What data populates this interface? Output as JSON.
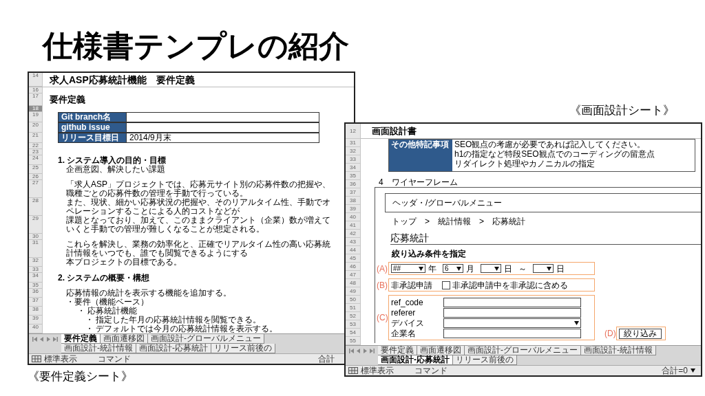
{
  "title": "仕様書テンプレの紹介",
  "requirements_sheet": {
    "caption": "《要件定義シート》",
    "rows": [
      {
        "num": "14",
        "kind": "title",
        "text": "求人ASP応募統計機能　要件定義",
        "selected": false
      },
      {
        "num": "16",
        "kind": "blank",
        "selected": false
      },
      {
        "num": "17",
        "kind": "heading",
        "text": "要件定義",
        "selected": false
      },
      {
        "num": "18",
        "kind": "blank",
        "selected": true
      },
      {
        "num": "19",
        "kind": "field",
        "label": "Git branch名",
        "selected": false
      },
      {
        "num": "20",
        "kind": "field",
        "label": "github issue",
        "selected": false
      },
      {
        "num": "21",
        "kind": "field",
        "label": "リリース目標日",
        "value": "2014/9月末",
        "selected": false
      },
      {
        "num": "22",
        "kind": "blank",
        "selected": false
      },
      {
        "num": "23",
        "kind": "blank",
        "selected": false
      },
      {
        "num": "24",
        "kind": "section",
        "text": "1.  システム導入の目的・目標",
        "selected": false
      },
      {
        "num": "25",
        "kind": "note",
        "text": "企画意図、解決したい課題",
        "selected": false
      },
      {
        "num": "26",
        "kind": "blank",
        "selected": false
      },
      {
        "num": "27",
        "kind": "para",
        "text": "「求人ASP」プロジェクトでは、応募元サイト別の応募件数の把握や、職種ごとの応募件数の管理を手動で行っている。",
        "selected": false
      },
      {
        "num": "28",
        "kind": "para",
        "text": "また、現状、細かい応募状況の把握や、そのリアルタイム性、手動でオペレーションすることによる人的コストなどが",
        "selected": false
      },
      {
        "num": "29",
        "kind": "para",
        "text": "課題となっており、加えて、このままクライアント（企業）数が増えていくと手動での管理が難しくなることが想定される。",
        "selected": false
      },
      {
        "num": "30",
        "kind": "blank",
        "selected": false
      },
      {
        "num": "31",
        "kind": "para",
        "text": "これらを解決し、業務の効率化と、正確でリアルタイム性の高い応募統計情報をいつでも、誰でも閲覧できるようにする",
        "selected": false
      },
      {
        "num": "32",
        "kind": "para",
        "text": "本プロジェクトの目標である。",
        "selected": false
      },
      {
        "num": "33",
        "kind": "blank",
        "selected": false
      },
      {
        "num": "34",
        "kind": "section",
        "text": "2.  システムの概要・構想",
        "selected": false
      },
      {
        "num": "35",
        "kind": "blank",
        "selected": false
      },
      {
        "num": "36",
        "kind": "para",
        "text": "応募情報の統計を表示する機能を追加する。",
        "selected": false
      },
      {
        "num": "37",
        "kind": "para",
        "text": "・要件（機能ベース）",
        "selected": false
      },
      {
        "num": "38",
        "kind": "item",
        "text": "・ 応募統計機能",
        "selected": false
      },
      {
        "num": "39",
        "kind": "subitem",
        "text": "・ 指定した年月の応募統計情報を閲覧できる。",
        "selected": false
      },
      {
        "num": "40",
        "kind": "subitem",
        "text": "・ デフォルトでは今月の応募統計情報を表示する。",
        "selected": false
      }
    ],
    "tabs": [
      {
        "label": "要件定義",
        "selected": true
      },
      {
        "label": "画面遷移図",
        "selected": false
      },
      {
        "label": "画面設計-グローバルメニュー",
        "selected": false
      },
      {
        "label": "画面設計-統計情報",
        "selected": false
      },
      {
        "label": "画面設計-応募統計",
        "selected": false
      },
      {
        "label": "リリース前後の",
        "selected": false
      }
    ],
    "status_bar": {
      "view": "標準表示",
      "mode": "コマンド",
      "sum": "合計"
    }
  },
  "design_sheet": {
    "caption": "《画面設計シート》",
    "row_numbers": [
      "12",
      "31",
      "32",
      "33",
      "34",
      "35",
      "36",
      "37",
      "38",
      "39",
      "40",
      "41",
      "42",
      "43",
      "44",
      "45",
      "46",
      "47",
      "48",
      "49",
      "50",
      "51",
      "52",
      "53",
      "54",
      "55"
    ],
    "heading": "画面設計書",
    "notes_table": {
      "label": "その他特記事項",
      "lines": [
        "SEO観点の考慮が必要であれば記入してください。",
        "h1の指定など特段SEO観点でのコーディングの留意点",
        "リダイレクト処理やカノニカルの指定"
      ]
    },
    "section": "4　ワイヤーフレーム",
    "wireframe": {
      "header": "ヘッダ・/グローバルメニュー",
      "breadcrumb": "トップ　>　統計情報　>　応募統計",
      "heading": "応募統計",
      "filter_title": "絞り込み条件を指定",
      "date_filter": {
        "marker": "(A)",
        "items": [
          {
            "kind": "select",
            "value": "##"
          },
          {
            "kind": "unit",
            "text": "年"
          },
          {
            "kind": "select",
            "value": "6"
          },
          {
            "kind": "unit",
            "text": "月"
          },
          {
            "kind": "select"
          },
          {
            "kind": "unit",
            "text": "日"
          },
          {
            "kind": "unit",
            "text": "～"
          },
          {
            "kind": "select"
          },
          {
            "kind": "unit",
            "text": "日"
          }
        ]
      },
      "approval_filter": {
        "marker": "(B)",
        "label": "非承認申請",
        "checkbox_label": "非承認申請中を非承認に含める",
        "checked": false
      },
      "field_filter": {
        "marker": "(C)",
        "fields": [
          {
            "label": "ref_code",
            "kind": "text"
          },
          {
            "label": "referer",
            "kind": "text"
          },
          {
            "label": "デバイス",
            "kind": "select"
          },
          {
            "label": "企業名",
            "kind": "text"
          }
        ]
      },
      "submit": {
        "marker": "(D)",
        "label": "絞り込み"
      }
    },
    "tabs": [
      {
        "label": "要件定義",
        "selected": false
      },
      {
        "label": "画面遷移図",
        "selected": false
      },
      {
        "label": "画面設計-グローバルメニュー",
        "selected": false
      },
      {
        "label": "画面設計-統計情報",
        "selected": false
      },
      {
        "label": "画面設計-応募統計",
        "selected": true
      },
      {
        "label": "リリース前後の",
        "selected": false
      }
    ],
    "status_bar": {
      "view": "標準表示",
      "mode": "コマンド",
      "sum": "合計=0"
    }
  }
}
